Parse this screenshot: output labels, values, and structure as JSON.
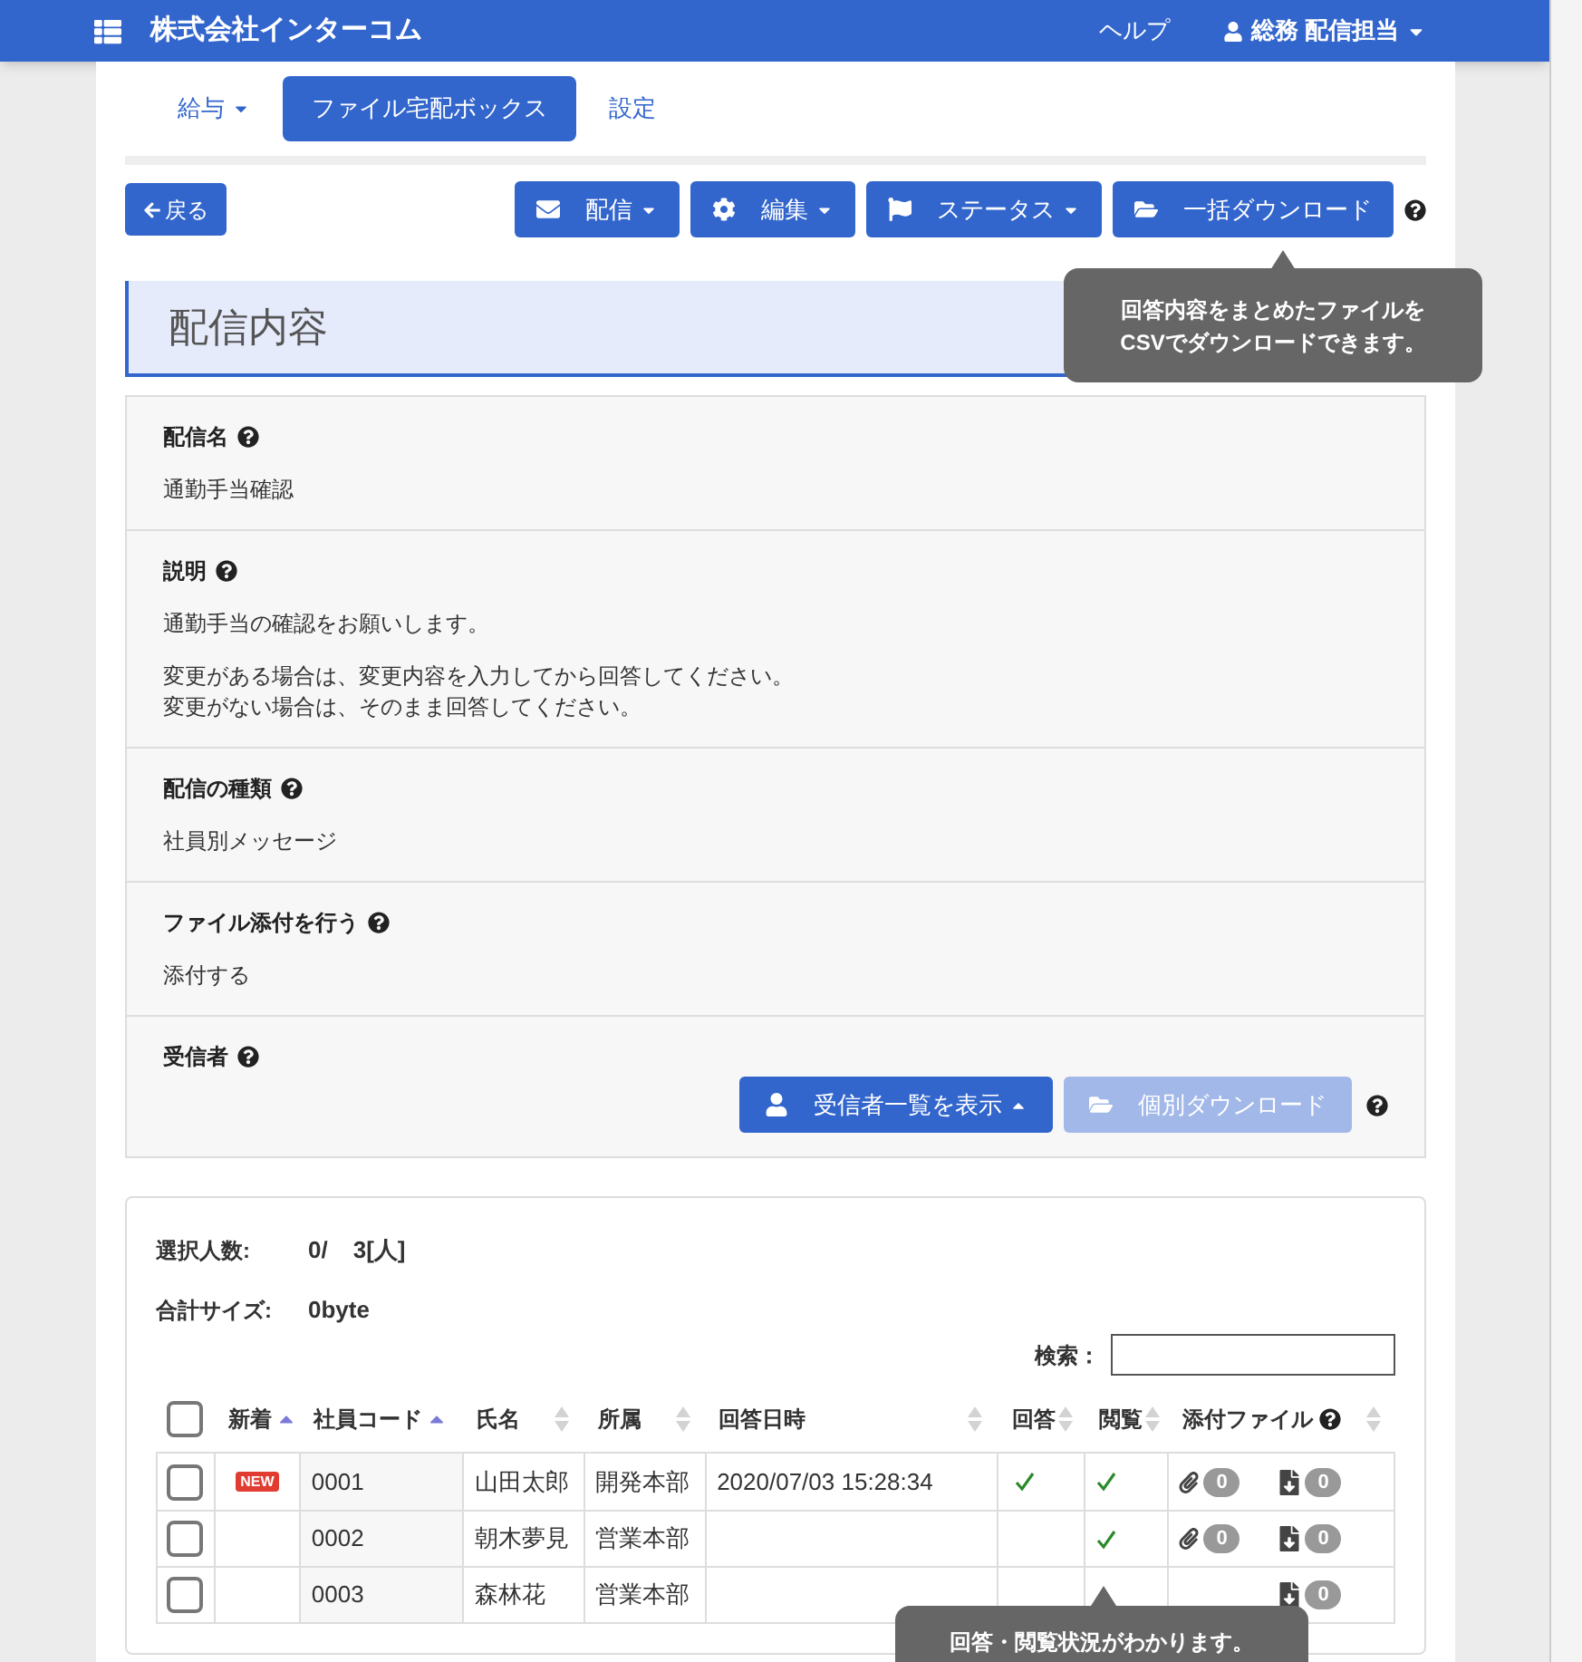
{
  "header": {
    "brand": "株式会社インターコム",
    "help_link": "ヘルプ",
    "user": "総務 配信担当"
  },
  "nav_tabs": [
    {
      "label": "給与",
      "dropdown": true,
      "selected": false
    },
    {
      "label": "ファイル宅配ボックス",
      "dropdown": false,
      "selected": true
    },
    {
      "label": "設定",
      "dropdown": false,
      "selected": false
    }
  ],
  "back_button": "戻る",
  "toolbar": [
    {
      "label": "配信",
      "kind": "mail",
      "dropdown": true
    },
    {
      "label": "編集",
      "kind": "gear",
      "dropdown": true
    },
    {
      "label": "ステータス",
      "kind": "flag",
      "dropdown": true
    },
    {
      "label": "一括ダウンロード",
      "kind": "folder",
      "dropdown": false
    }
  ],
  "toolbar_tooltip": "回答内容をまとめたファイルを\nCSVでダウンロードできます。",
  "heading": "配信内容",
  "fields": [
    {
      "label": "配信名",
      "paragraphs": [
        [
          "通勤手当確認"
        ]
      ]
    },
    {
      "label": "説明",
      "paragraphs": [
        [
          "通勤手当の確認をお願いします。"
        ],
        [
          "変更がある場合は、変更内容を入力してから回答してください。",
          "変更がない場合は、そのまま回答してください。"
        ]
      ]
    },
    {
      "label": "配信の種類",
      "paragraphs": [
        [
          "社員別メッセージ"
        ]
      ]
    },
    {
      "label": "ファイル添付を行う",
      "paragraphs": [
        [
          "添付する"
        ]
      ]
    },
    {
      "label": "受信者"
    }
  ],
  "recipient_buttons": [
    {
      "label": "受信者一覧を表示",
      "kind": "user",
      "expanded": true,
      "disabled": false
    },
    {
      "label": "個別ダウンロード",
      "kind": "folder",
      "expanded": false,
      "disabled": true
    }
  ],
  "summary": [
    {
      "label": "選択人数:",
      "values": [
        "0/",
        "3[人]"
      ]
    },
    {
      "label": "合計サイズ:",
      "values": [
        "0byte"
      ]
    }
  ],
  "search": {
    "label": "検索："
  },
  "table": {
    "select_all": {
      "checked": false
    },
    "columns": [
      {
        "label": "新着",
        "sorted": true,
        "help": false
      },
      {
        "label": "社員コード",
        "sorted": true,
        "help": false
      },
      {
        "label": "氏名",
        "sorted": false,
        "help": false
      },
      {
        "label": "所属",
        "sorted": false,
        "help": false
      },
      {
        "label": "回答日時",
        "sorted": false,
        "help": false
      },
      {
        "label": "回答",
        "sorted": false,
        "help": false
      },
      {
        "label": "閲覧",
        "sorted": false,
        "help": false
      },
      {
        "label": "添付ファイル",
        "sorted": false,
        "help": true
      }
    ],
    "rows": [
      {
        "checked": false,
        "new": "NEW",
        "code": "0001",
        "name": "山田太郎",
        "dept": "開発本部",
        "answered_at": "2020/07/03 15:28:34",
        "answered": true,
        "viewed": true,
        "attachments": "0",
        "downloads": "0"
      },
      {
        "checked": false,
        "code": "0002",
        "name": "朝木夢見",
        "dept": "営業本部",
        "answered": false,
        "viewed": true,
        "attachments": "0",
        "downloads": "0"
      },
      {
        "checked": false,
        "code": "0003",
        "name": "森林花",
        "dept": "営業本部",
        "answered": false,
        "viewed": false,
        "downloads": "0"
      }
    ]
  },
  "table_tooltip": "回答・閲覧状況がわかります。"
}
